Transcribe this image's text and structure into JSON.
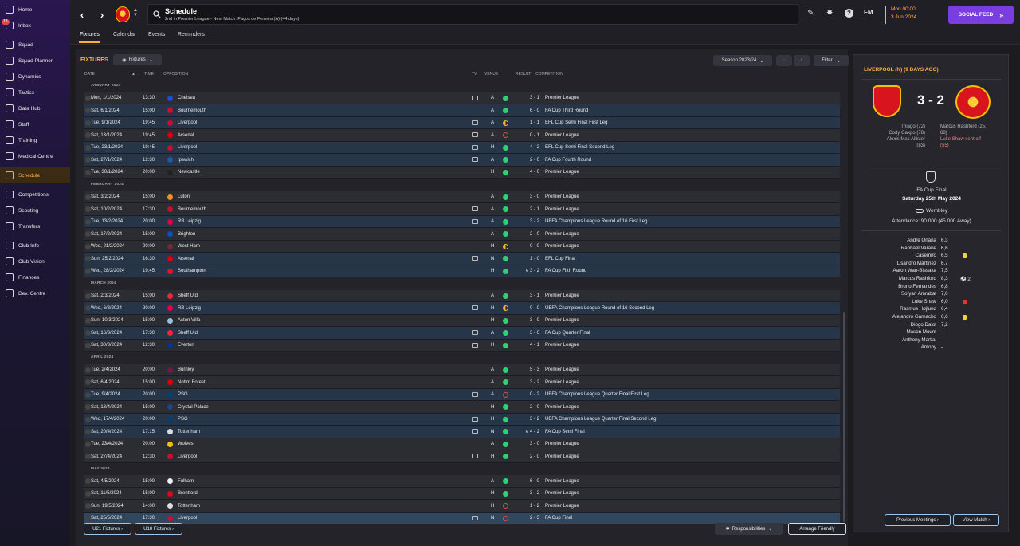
{
  "nav": {
    "items": [
      {
        "label": "Home",
        "icon": "home-icon"
      },
      {
        "label": "Inbox",
        "icon": "inbox-icon",
        "badge": "13"
      },
      {
        "label": "Squad",
        "icon": "squad-icon"
      },
      {
        "label": "Squad Planner",
        "icon": "squad-planner-icon"
      },
      {
        "label": "Dynamics",
        "icon": "dynamics-icon"
      },
      {
        "label": "Tactics",
        "icon": "tactics-icon"
      },
      {
        "label": "Data Hub",
        "icon": "data-hub-icon"
      },
      {
        "label": "Staff",
        "icon": "staff-icon"
      },
      {
        "label": "Training",
        "icon": "training-icon"
      },
      {
        "label": "Medical Centre",
        "icon": "medical-icon"
      },
      {
        "label": "Schedule",
        "icon": "schedule-icon"
      },
      {
        "label": "Competitions",
        "icon": "trophy-icon"
      },
      {
        "label": "Scouting",
        "icon": "scouting-icon"
      },
      {
        "label": "Transfers",
        "icon": "transfers-icon"
      },
      {
        "label": "Club Info",
        "icon": "club-info-icon"
      },
      {
        "label": "Club Vision",
        "icon": "club-vision-icon"
      },
      {
        "label": "Finances",
        "icon": "finances-icon"
      },
      {
        "label": "Dev. Centre",
        "icon": "dev-centre-icon"
      }
    ]
  },
  "header": {
    "back": "‹",
    "forward": "›",
    "title": "Schedule",
    "subtitle": "2nd in Premier League - Next Match: Paços de Ferreira (A) (44 days)",
    "fm_label": "FM",
    "date_time": "Mon 00:00",
    "date_day": "3 Jun 2024",
    "social_feed": "SOCIAL FEED",
    "colors": {
      "accent": "#ffae3c",
      "social": "#7a3ee0"
    }
  },
  "subtabs": [
    "Fixtures",
    "Calendar",
    "Events",
    "Reminders"
  ],
  "fixtures": {
    "title": "FIXTURES",
    "view_dropdown": "Fixtures",
    "season": "Season 2023/24",
    "filter": "Filter",
    "columns": {
      "date": "DATE",
      "time": "TIME",
      "opposition": "OPPOSITION",
      "tv": "TV",
      "venue": "VENUE",
      "result": "RESULT",
      "competition": "COMPETITION"
    },
    "groups": [
      {
        "month": "JANUARY 2024",
        "rows": [
          {
            "date": "Mon, 1/1/2024",
            "time": "13:30",
            "opp": "Chelsea",
            "crest": "#1d4ed8",
            "tv": true,
            "venue": "A",
            "result": "W",
            "score": "3 - 1",
            "comp": "Premier League",
            "alt": false
          },
          {
            "date": "Sat, 6/1/2024",
            "time": "15:00",
            "opp": "Bournemouth",
            "crest": "#c8102e",
            "tv": false,
            "venue": "A",
            "result": "W",
            "score": "6 - 0",
            "comp": "FA Cup Third Round",
            "alt": true
          },
          {
            "date": "Tue, 9/1/2024",
            "time": "19:45",
            "opp": "Liverpool",
            "crest": "#c8102e",
            "tv": true,
            "venue": "A",
            "result": "D",
            "score": "1 - 1",
            "comp": "EFL Cup Semi Final First Leg",
            "alt": true
          },
          {
            "date": "Sat, 13/1/2024",
            "time": "19:45",
            "opp": "Arsenal",
            "crest": "#db0007",
            "tv": true,
            "venue": "A",
            "result": "L",
            "score": "0 - 1",
            "comp": "Premier League",
            "alt": false
          },
          {
            "date": "Tue, 23/1/2024",
            "time": "19:45",
            "opp": "Liverpool",
            "crest": "#c8102e",
            "tv": true,
            "venue": "H",
            "result": "W",
            "score": "4 - 2",
            "comp": "EFL Cup Semi Final Second Leg",
            "alt": true
          },
          {
            "date": "Sat, 27/1/2024",
            "time": "12:30",
            "opp": "Ipswich",
            "crest": "#1e5aa8",
            "tv": true,
            "venue": "A",
            "result": "W",
            "score": "2 - 0",
            "comp": "FA Cup Fourth Round",
            "alt": true
          },
          {
            "date": "Tue, 30/1/2024",
            "time": "20:00",
            "opp": "Newcastle",
            "crest": "#222222",
            "tv": false,
            "venue": "H",
            "result": "W",
            "score": "4 - 0",
            "comp": "Premier League",
            "alt": false
          }
        ]
      },
      {
        "month": "FEBRUARY 2024",
        "rows": [
          {
            "date": "Sat, 3/2/2024",
            "time": "15:00",
            "opp": "Luton",
            "crest": "#f78f1e",
            "tv": false,
            "venue": "A",
            "result": "W",
            "score": "3 - 0",
            "comp": "Premier League",
            "alt": false
          },
          {
            "date": "Sat, 10/2/2024",
            "time": "17:30",
            "opp": "Bournemouth",
            "crest": "#c8102e",
            "tv": true,
            "venue": "A",
            "result": "W",
            "score": "2 - 1",
            "comp": "Premier League",
            "alt": false
          },
          {
            "date": "Tue, 13/2/2024",
            "time": "20:00",
            "opp": "RB Leipzig",
            "crest": "#dd0741",
            "tv": true,
            "venue": "A",
            "result": "W",
            "score": "3 - 2",
            "comp": "UEFA Champions League Round of 16 First Leg",
            "alt": true
          },
          {
            "date": "Sat, 17/2/2024",
            "time": "15:00",
            "opp": "Brighton",
            "crest": "#0057b8",
            "tv": false,
            "venue": "A",
            "result": "W",
            "score": "2 - 0",
            "comp": "Premier League",
            "alt": false
          },
          {
            "date": "Wed, 21/2/2024",
            "time": "20:00",
            "opp": "West Ham",
            "crest": "#7a263a",
            "tv": false,
            "venue": "H",
            "result": "D",
            "score": "0 - 0",
            "comp": "Premier League",
            "alt": false
          },
          {
            "date": "Sun, 25/2/2024",
            "time": "16:30",
            "opp": "Arsenal",
            "crest": "#db0007",
            "tv": true,
            "venue": "N",
            "result": "W",
            "score": "1 - 0",
            "comp": "EFL Cup Final",
            "alt": true
          },
          {
            "date": "Wed, 28/2/2024",
            "time": "19:45",
            "opp": "Southampton",
            "crest": "#d71920",
            "tv": false,
            "venue": "H",
            "result": "W",
            "score": "e 3 - 2",
            "comp": "FA Cup Fifth Round",
            "alt": true
          }
        ]
      },
      {
        "month": "MARCH 2024",
        "rows": [
          {
            "date": "Sat, 2/3/2024",
            "time": "15:00",
            "opp": "Sheff Utd",
            "crest": "#ee2737",
            "tv": false,
            "venue": "A",
            "result": "W",
            "score": "3 - 1",
            "comp": "Premier League",
            "alt": false
          },
          {
            "date": "Wed, 6/3/2024",
            "time": "20:00",
            "opp": "RB Leipzig",
            "crest": "#dd0741",
            "tv": true,
            "venue": "H",
            "result": "D",
            "score": "0 - 0",
            "comp": "UEFA Champions League Round of 16 Second Leg",
            "alt": true
          },
          {
            "date": "Sun, 10/3/2024",
            "time": "15:00",
            "opp": "Aston Villa",
            "crest": "#95bfe5",
            "tv": false,
            "venue": "H",
            "result": "W",
            "score": "3 - 0",
            "comp": "Premier League",
            "alt": false
          },
          {
            "date": "Sat, 16/3/2024",
            "time": "17:30",
            "opp": "Sheff Utd",
            "crest": "#ee2737",
            "tv": true,
            "venue": "A",
            "result": "W",
            "score": "3 - 0",
            "comp": "FA Cup Quarter Final",
            "alt": true
          },
          {
            "date": "Sat, 30/3/2024",
            "time": "12:30",
            "opp": "Everton",
            "crest": "#003399",
            "tv": true,
            "venue": "H",
            "result": "W",
            "score": "4 - 1",
            "comp": "Premier League",
            "alt": false
          }
        ]
      },
      {
        "month": "APRIL 2024",
        "rows": [
          {
            "date": "Tue, 2/4/2024",
            "time": "20:00",
            "opp": "Burnley",
            "crest": "#6c1d45",
            "tv": false,
            "venue": "A",
            "result": "W",
            "score": "5 - 3",
            "comp": "Premier League",
            "alt": false
          },
          {
            "date": "Sat, 6/4/2024",
            "time": "15:00",
            "opp": "Nottm Forest",
            "crest": "#dd0000",
            "tv": false,
            "venue": "A",
            "result": "W",
            "score": "3 - 2",
            "comp": "Premier League",
            "alt": false
          },
          {
            "date": "Tue, 9/4/2024",
            "time": "20:00",
            "opp": "PSG",
            "crest": "#004170",
            "tv": true,
            "venue": "A",
            "result": "L",
            "score": "0 - 2",
            "comp": "UEFA Champions League Quarter Final First Leg",
            "alt": true
          },
          {
            "date": "Sat, 13/4/2024",
            "time": "15:00",
            "opp": "Crystal Palace",
            "crest": "#1b458f",
            "tv": false,
            "venue": "H",
            "result": "W",
            "score": "2 - 0",
            "comp": "Premier League",
            "alt": false
          },
          {
            "date": "Wed, 17/4/2024",
            "time": "20:00",
            "opp": "PSG",
            "crest": "#004170",
            "tv": true,
            "venue": "H",
            "result": "W",
            "score": "3 - 2",
            "comp": "UEFA Champions League Quarter Final Second Leg",
            "alt": true
          },
          {
            "date": "Sat, 20/4/2024",
            "time": "17:15",
            "opp": "Tottenham",
            "crest": "#dddddd",
            "tv": true,
            "venue": "N",
            "result": "W",
            "score": "e 4 - 2",
            "comp": "FA Cup Semi Final",
            "alt": true
          },
          {
            "date": "Tue, 23/4/2024",
            "time": "20:00",
            "opp": "Wolves",
            "crest": "#fdb913",
            "tv": false,
            "venue": "A",
            "result": "W",
            "score": "3 - 0",
            "comp": "Premier League",
            "alt": false
          },
          {
            "date": "Sat, 27/4/2024",
            "time": "12:30",
            "opp": "Liverpool",
            "crest": "#c8102e",
            "tv": true,
            "venue": "H",
            "result": "W",
            "score": "2 - 0",
            "comp": "Premier League",
            "alt": false
          }
        ]
      },
      {
        "month": "MAY 2024",
        "rows": [
          {
            "date": "Sat, 4/5/2024",
            "time": "15:00",
            "opp": "Fulham",
            "crest": "#eeeeee",
            "tv": false,
            "venue": "A",
            "result": "W",
            "score": "6 - 0",
            "comp": "Premier League",
            "alt": false
          },
          {
            "date": "Sat, 11/5/2024",
            "time": "15:00",
            "opp": "Brentford",
            "crest": "#e30613",
            "tv": false,
            "venue": "H",
            "result": "W",
            "score": "3 - 2",
            "comp": "Premier League",
            "alt": false
          },
          {
            "date": "Sun, 19/5/2024",
            "time": "14:00",
            "opp": "Tottenham",
            "crest": "#dddddd",
            "tv": false,
            "venue": "H",
            "result": "L",
            "score": "1 - 2",
            "comp": "Premier League",
            "alt": false
          },
          {
            "date": "Sat, 25/5/2024",
            "time": "17:30",
            "opp": "Liverpool",
            "crest": "#c8102e",
            "tv": true,
            "venue": "N",
            "result": "L",
            "score": "2 - 3",
            "comp": "FA Cup Final",
            "alt": false,
            "last": true
          }
        ]
      }
    ],
    "u21": "U21 Fixtures ›",
    "u18": "U18 Fixtures ›",
    "responsibilities": "Responsibilities",
    "arrange_friendly": "Arrange Friendly"
  },
  "match": {
    "header": "LIVERPOOL (N) (9 DAYS AGO)",
    "score": "3 - 2",
    "home_scorers": [
      "Thiago (72)",
      "Cody Gakpo (78)",
      "Alexis Mac Allister",
      "(83)"
    ],
    "away_scorers": [
      "Marcus Rashford (25,",
      "88)",
      "Luke Shaw sent off",
      "(55)"
    ],
    "competition": "FA Cup Final",
    "date": "Saturday 25th May 2024",
    "venue": "Wembley",
    "attendance": "Attendance: 90.000 (45.000 Away)",
    "lineup": [
      {
        "name": "André Onana",
        "rating": "6,3",
        "event": ""
      },
      {
        "name": "Raphaël Varane",
        "rating": "6,6",
        "event": ""
      },
      {
        "name": "Casemiro",
        "rating": "6,5",
        "event": "yellow"
      },
      {
        "name": "Lisandro Martínez",
        "rating": "6,7",
        "event": ""
      },
      {
        "name": "Aaron Wan-Bissaka",
        "rating": "7,5",
        "event": ""
      },
      {
        "name": "Marcus Rashford",
        "rating": "8,3",
        "event": "goal",
        "goals": "⚽ 2"
      },
      {
        "name": "Bruno Fernandes",
        "rating": "6,8",
        "event": ""
      },
      {
        "name": "Sofyan Amrabat",
        "rating": "7,0",
        "event": ""
      },
      {
        "name": "Luke Shaw",
        "rating": "6,0",
        "event": "red"
      },
      {
        "name": "Rasmus Højlund",
        "rating": "6,4",
        "event": ""
      },
      {
        "name": "Alejandro Garnacho",
        "rating": "6,6",
        "event": "yellow"
      },
      {
        "name": "Diogo Dalot",
        "rating": "7,2",
        "event": ""
      },
      {
        "name": "Mason Mount",
        "rating": "-",
        "event": ""
      },
      {
        "name": "Anthony Martial",
        "rating": "-",
        "event": ""
      },
      {
        "name": "Antony",
        "rating": "-",
        "event": ""
      }
    ],
    "previous_meetings": "Previous Meetings ›",
    "view_match": "View Match ›"
  }
}
